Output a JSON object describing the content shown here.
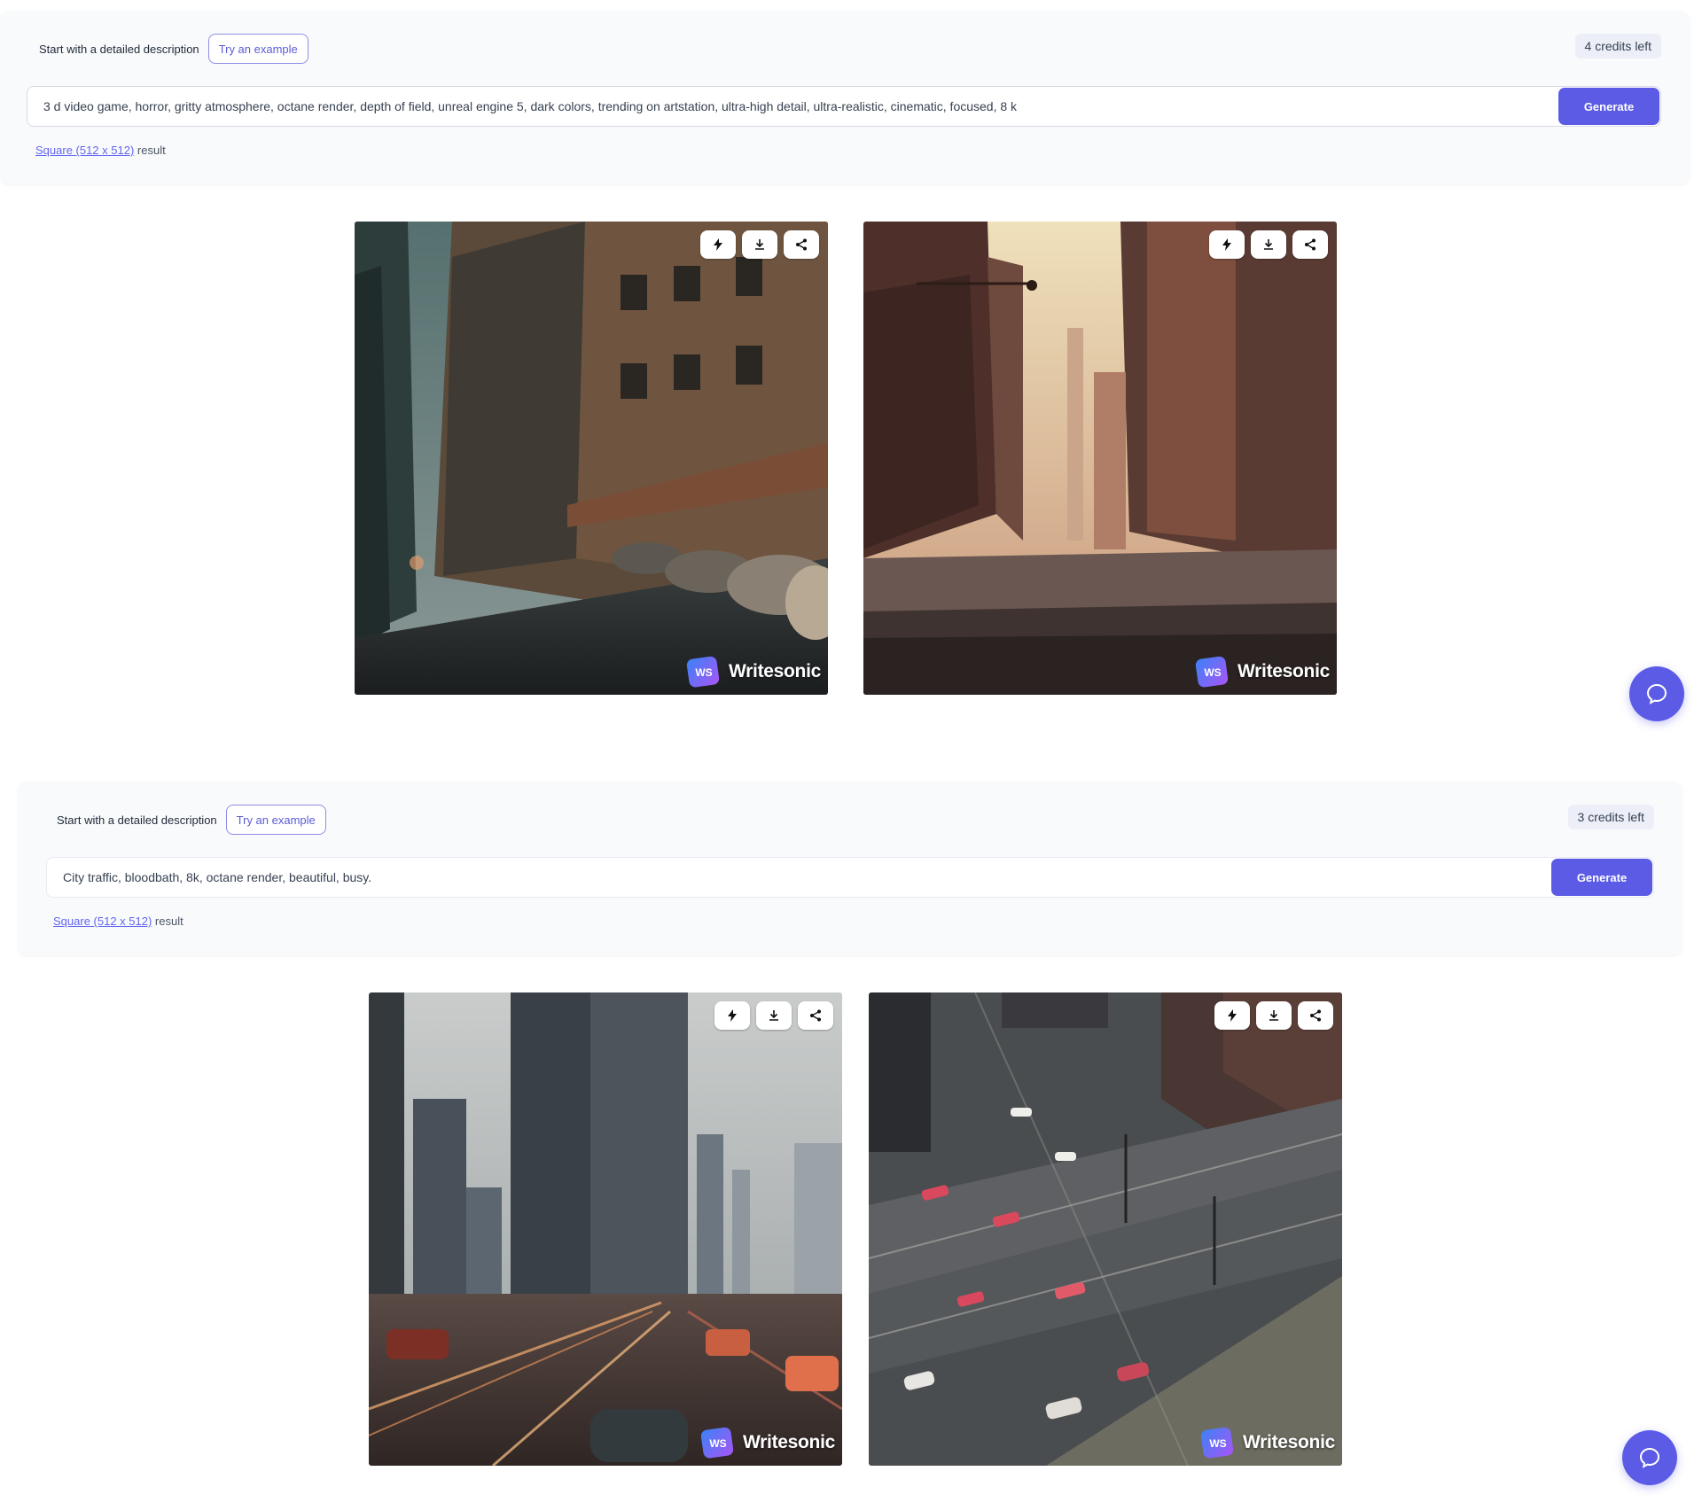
{
  "sections": [
    {
      "description_label": "Start with a detailed description",
      "try_example_label": "Try an example",
      "credits_label": "4 credits left",
      "prompt_value": "3 d video game, horror, gritty atmosphere, octane render, depth of field, unreal engine 5, dark colors, trending on artstation, ultra-high detail, ultra-realistic, cinematic, focused, 8 k",
      "generate_label": "Generate",
      "size_link": "Square (512 x 512)",
      "size_suffix": "result",
      "images": [
        {
          "brand": "Writesonic",
          "logo": "WS"
        },
        {
          "brand": "Writesonic",
          "logo": "WS"
        }
      ]
    },
    {
      "description_label": "Start with a detailed description",
      "try_example_label": "Try an example",
      "credits_label": "3 credits left",
      "prompt_value": "City traffic, bloodbath, 8k, octane render, beautiful, busy.",
      "generate_label": "Generate",
      "size_link": "Square (512 x 512)",
      "size_suffix": "result",
      "images": [
        {
          "brand": "Writesonic",
          "logo": "WS"
        },
        {
          "brand": "Writesonic",
          "logo": "WS"
        }
      ]
    }
  ],
  "icons": {
    "card_tools": [
      "bolt-icon",
      "download-icon",
      "share-icon"
    ],
    "chat": "chat-bubble-icon"
  },
  "colors": {
    "accent": "#5b5be6",
    "panel_bg": "#f9fafc",
    "credits_bg": "#eceff8",
    "logo_gradient_start": "#3b82f6",
    "logo_gradient_end": "#a855f7"
  }
}
